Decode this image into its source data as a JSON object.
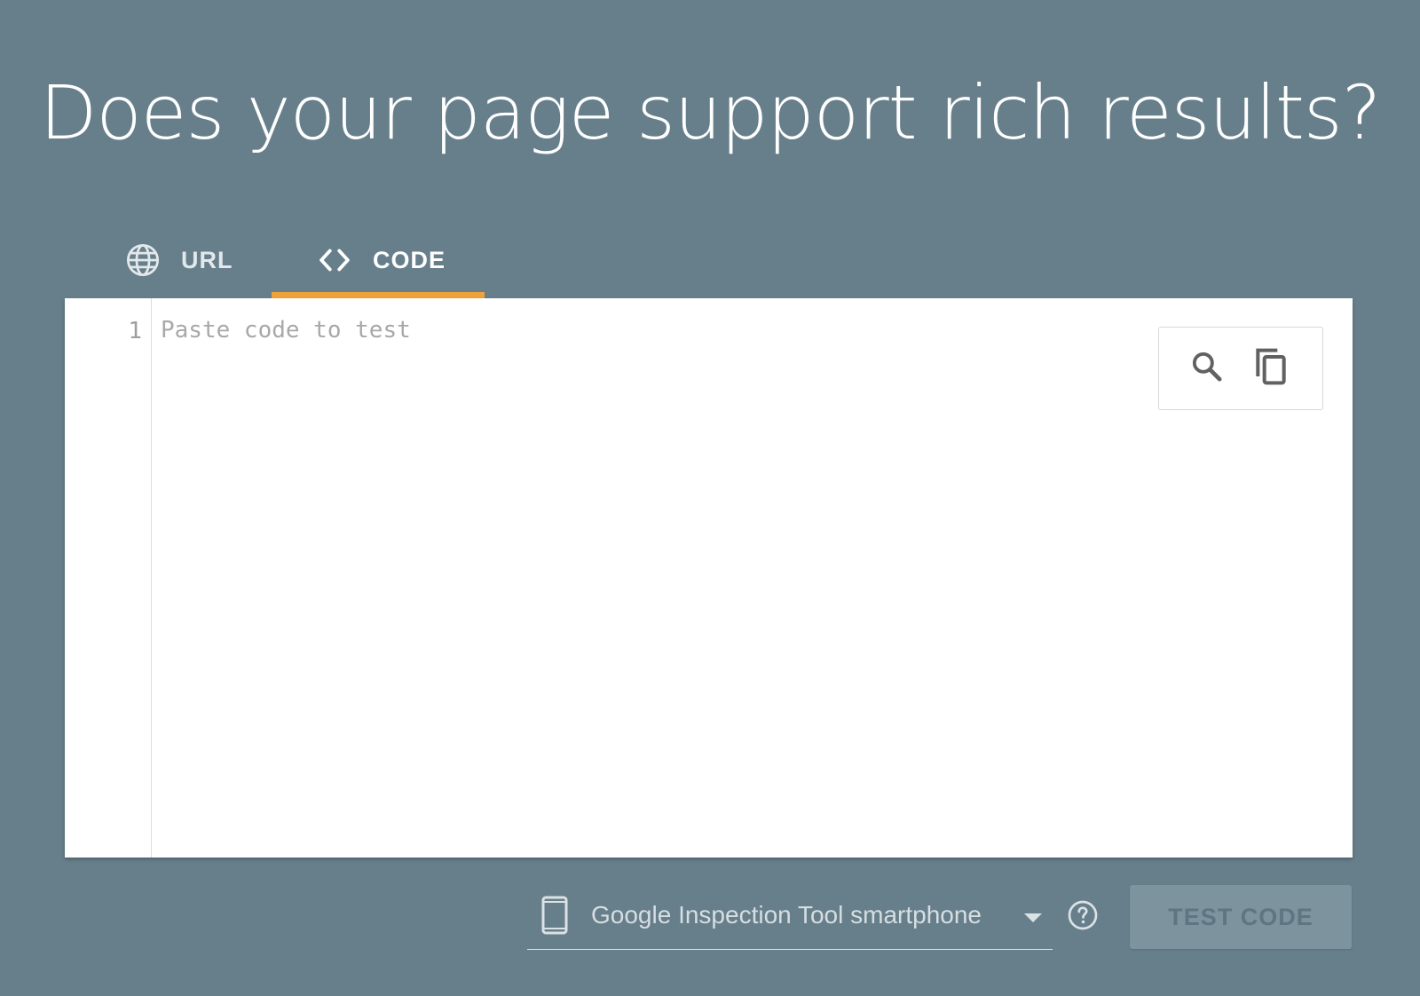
{
  "page": {
    "title": "Does your page support rich results?"
  },
  "tabs": [
    {
      "label": "URL",
      "icon": "globe-icon",
      "selected": false
    },
    {
      "label": "CODE",
      "icon": "code-brackets-icon",
      "selected": true
    }
  ],
  "editor": {
    "line_numbers": [
      "1"
    ],
    "value": "",
    "placeholder": "Paste code to test",
    "tools": [
      {
        "icon": "search-icon"
      },
      {
        "icon": "copy-icon"
      }
    ]
  },
  "controls": {
    "device": {
      "icon": "smartphone-icon",
      "selected": "Google Inspection Tool smartphone"
    },
    "help_icon": "help-circle-icon",
    "test_button_label": "TEST CODE"
  },
  "colors": {
    "background": "#677f8b",
    "tab_indicator": "#f0a23a",
    "editor_background": "#ffffff",
    "button_disabled": "#7d939e"
  }
}
